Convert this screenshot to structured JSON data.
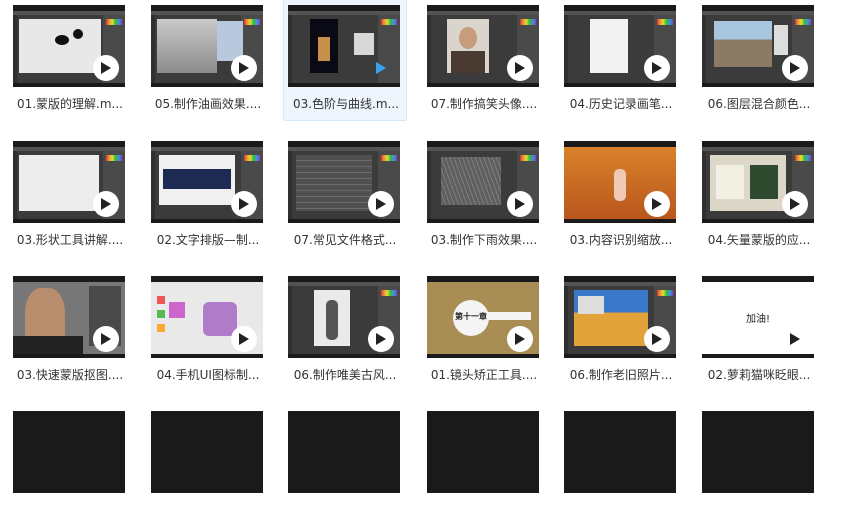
{
  "videos": [
    {
      "caption": "01.蒙版的理解.m...",
      "thumb": "blank-canvas-blobs"
    },
    {
      "caption": "05.制作油画效果....",
      "thumb": "dialog-gray"
    },
    {
      "caption": "03.色阶与曲线.m...",
      "thumb": "night-castle",
      "selected": true
    },
    {
      "caption": "07.制作搞笑头像....",
      "thumb": "portrait-man"
    },
    {
      "caption": "04.历史记录画笔...",
      "thumb": "white-page"
    },
    {
      "caption": "06.图层混合颜色...",
      "thumb": "building"
    },
    {
      "caption": "03.形状工具讲解....",
      "thumb": "light-canvas"
    },
    {
      "caption": "02.文字排版—制...",
      "thumb": "blue-panels"
    },
    {
      "caption": "07.常见文件格式...",
      "thumb": "file-list"
    },
    {
      "caption": "03.制作下雨效果....",
      "thumb": "rain"
    },
    {
      "caption": "03.内容识别缩放...",
      "thumb": "autumn-girl"
    },
    {
      "caption": "04.矢量蒙版的应...",
      "thumb": "vector-cards"
    },
    {
      "caption": "03.快速蒙版抠图....",
      "thumb": "man-beard"
    },
    {
      "caption": "04.手机UI图标制...",
      "thumb": "ui-icons"
    },
    {
      "caption": "06.制作唯美古风...",
      "thumb": "ancient-figure"
    },
    {
      "caption": "01.镜头矫正工具....",
      "thumb": "chapter-eleven",
      "overlay_text": "第十一章"
    },
    {
      "caption": "06.制作老旧照片...",
      "thumb": "wheat-field"
    },
    {
      "caption": "02.萝莉猫咪眨眼...",
      "thumb": "cheer-text",
      "overlay_text": "加油!"
    },
    {
      "caption": "",
      "thumb": "dark"
    },
    {
      "caption": "",
      "thumb": "dark"
    },
    {
      "caption": "",
      "thumb": "dark"
    },
    {
      "caption": "",
      "thumb": "dark"
    },
    {
      "caption": "",
      "thumb": "dark"
    },
    {
      "caption": "",
      "thumb": "dark"
    }
  ],
  "colors": {
    "selected_bg": "#eef5fd",
    "play_accent": "#3aa0f0",
    "thumb_bg": "#1a1a1a"
  }
}
